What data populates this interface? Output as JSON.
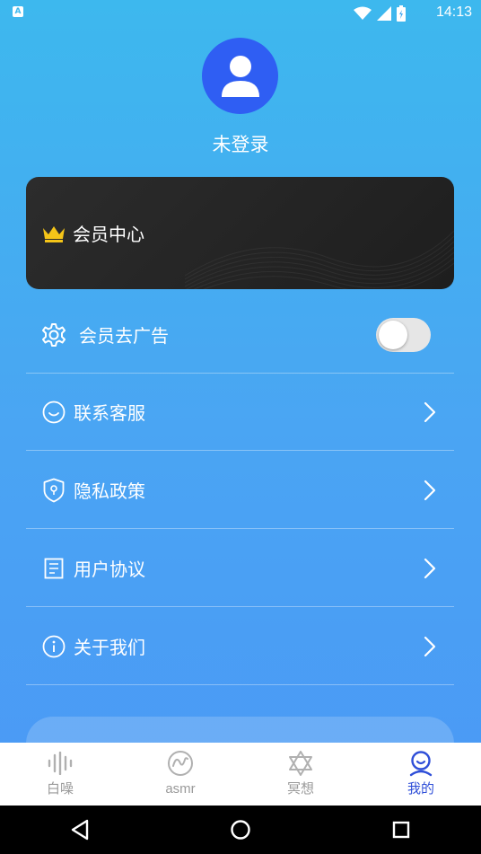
{
  "status_bar": {
    "notification_icon": "A",
    "time": "14:13",
    "icons": [
      "wifi-icon",
      "signal-icon",
      "battery-icon"
    ]
  },
  "profile": {
    "avatar_icon": "user-icon",
    "username": "未登录"
  },
  "vip_card": {
    "icon": "crown-icon",
    "label": "会员中心"
  },
  "menu": {
    "ad_free": {
      "icon": "gear-icon",
      "label": "会员去广告",
      "toggle_on": false
    },
    "items": [
      {
        "icon": "smile-icon",
        "label": "联系客服"
      },
      {
        "icon": "shield-icon",
        "label": "隐私政策"
      },
      {
        "icon": "document-icon",
        "label": "用户协议"
      },
      {
        "icon": "info-icon",
        "label": "关于我们"
      }
    ]
  },
  "logout": {
    "label": ""
  },
  "bottom_nav": {
    "items": [
      {
        "icon": "soundwave-icon",
        "label": "白噪",
        "active": false
      },
      {
        "icon": "asmr-wave-icon",
        "label": "asmr",
        "active": false
      },
      {
        "icon": "star-of-david-icon",
        "label": "冥想",
        "active": false
      },
      {
        "icon": "user-face-icon",
        "label": "我的",
        "active": true
      }
    ]
  },
  "colors": {
    "accent": "#2f4fd8",
    "avatar_bg": "#2f5ef3",
    "gradient_top": "#3db8ee",
    "gradient_bottom": "#4b97f6",
    "crown": "#f5c518"
  }
}
